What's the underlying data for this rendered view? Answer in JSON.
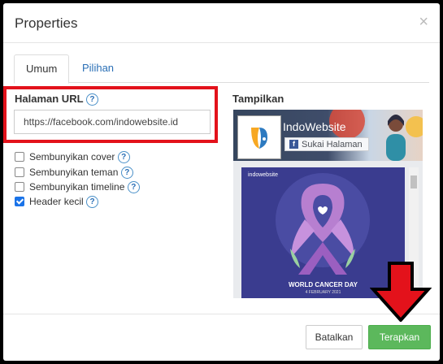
{
  "dialog": {
    "title": "Properties",
    "close_glyph": "×"
  },
  "tabs": [
    {
      "label": "Umum",
      "active": true
    },
    {
      "label": "Pilihan",
      "active": false
    }
  ],
  "url_field": {
    "label": "Halaman URL",
    "value": "https://facebook.com/indowebsite.id"
  },
  "help_glyph": "?",
  "options": [
    {
      "label": "Sembunyikan cover",
      "checked": false
    },
    {
      "label": "Sembunyikan teman",
      "checked": false
    },
    {
      "label": "Sembunyikan timeline",
      "checked": false
    },
    {
      "label": "Header kecil",
      "checked": true
    }
  ],
  "preview": {
    "label": "Tampilkan",
    "page_name": "IndoWebsite",
    "like_label": "Sukai Halaman",
    "fb_glyph": "f",
    "post_brand": "indowebsite",
    "post_caption": "WORLD CANCER DAY",
    "post_date": "4 FEBRUARY 2021"
  },
  "footer": {
    "cancel_label": "Batalkan",
    "apply_label": "Terapkan"
  },
  "colors": {
    "highlight_box": "#e3121b",
    "apply_button": "#5cb85c",
    "link": "#2a6fb6",
    "post_background": "#3a3c8f",
    "ribbon": "#b77fd0"
  },
  "icons": {
    "close": "close-icon",
    "help": "help-icon",
    "facebook": "facebook-icon",
    "annotation_arrow": "arrow-down-icon"
  }
}
